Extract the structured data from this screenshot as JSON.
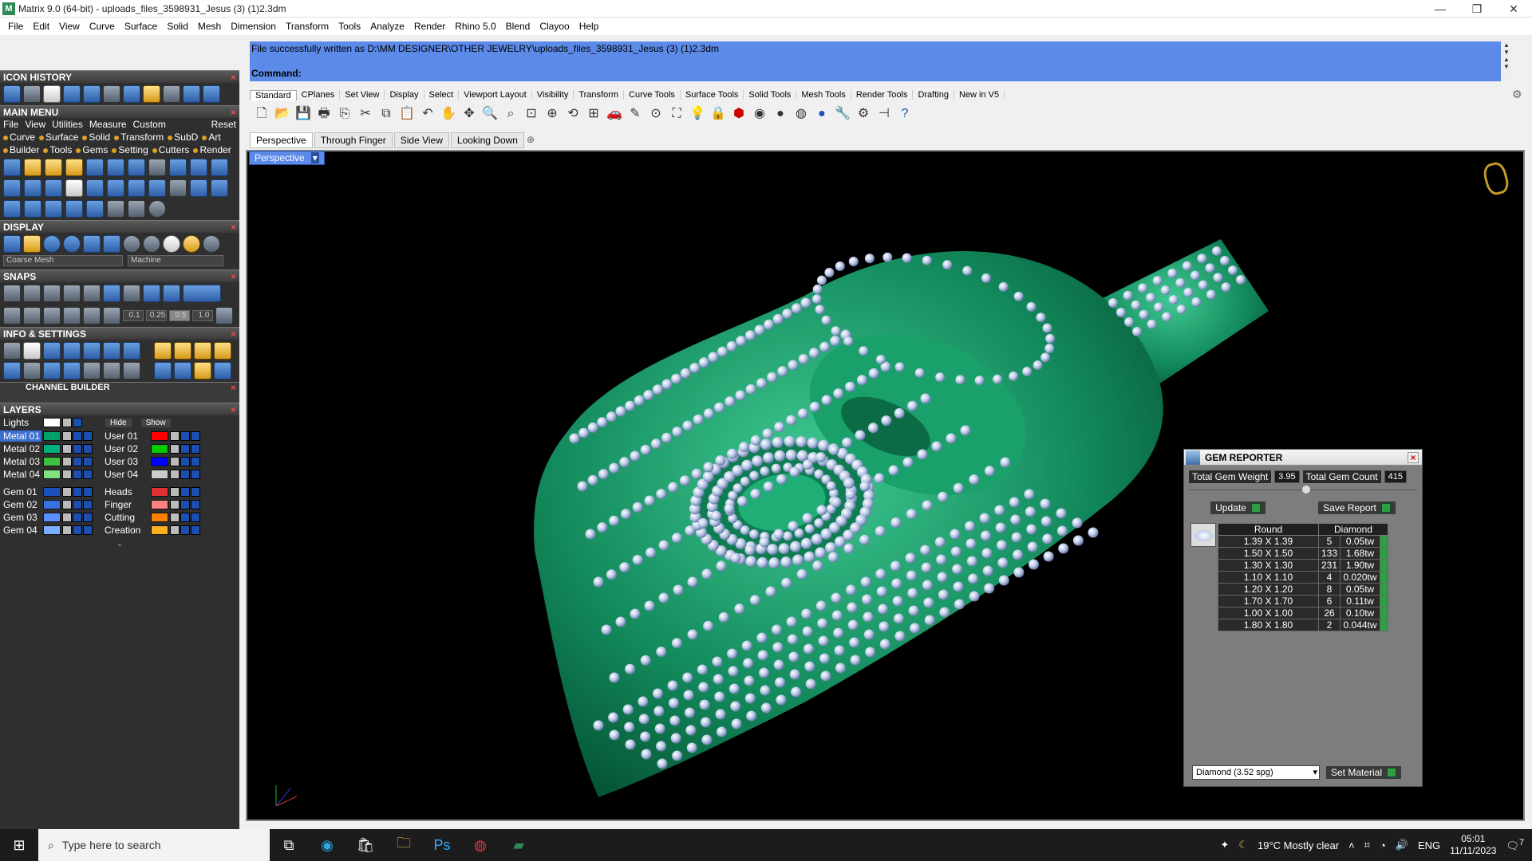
{
  "window": {
    "title": "Matrix 9.0 (64-bit) - uploads_files_3598931_Jesus (3) (1)2.3dm",
    "icon": "matrix-app-icon"
  },
  "menu": [
    "File",
    "Edit",
    "View",
    "Curve",
    "Surface",
    "Solid",
    "Mesh",
    "Dimension",
    "Transform",
    "Tools",
    "Analyze",
    "Render",
    "Rhino 5.0",
    "Blend",
    "Clayoo",
    "Help"
  ],
  "left_panel": {
    "icon_history": "ICON HISTORY",
    "main_menu": "MAIN MENU",
    "main_menu_items": [
      "File",
      "View",
      "Utilities",
      "Measure",
      "Custom",
      "Reset"
    ],
    "main_menu_row2": [
      "Curve",
      "Surface",
      "Solid",
      "Transform",
      "SubD",
      "Art"
    ],
    "main_menu_row3": [
      "Builder",
      "Tools",
      "Gems",
      "Setting",
      "Cutters",
      "Render"
    ],
    "display": "DISPLAY",
    "display_mesh": "Coarse Mesh",
    "display_mode": "Machine",
    "snaps": "SNAPS",
    "snap_values": [
      "0.1",
      "0.25",
      "0.5",
      "1.0"
    ],
    "info_settings": "INFO & SETTINGS",
    "channel_builder": "CHANNEL BUILDER",
    "layers": "LAYERS",
    "lights": "Lights",
    "hide": "Hide",
    "show": "Show",
    "layer_rows": [
      {
        "left": "Metal 01",
        "left_color": "#00a06a",
        "right": "User 01",
        "right_color": "#ff0000"
      },
      {
        "left": "Metal 02",
        "left_color": "#00b080",
        "right": "User 02",
        "right_color": "#00cc00"
      },
      {
        "left": "Metal 03",
        "left_color": "#40c040",
        "right": "User 03",
        "right_color": "#0000ff"
      },
      {
        "left": "Metal 04",
        "left_color": "#80e080",
        "right": "User 04",
        "right_color": "#cccccc"
      },
      {
        "left": "Gem 01",
        "left_color": "#1a50c0",
        "right": "Heads",
        "right_color": "#e03030"
      },
      {
        "left": "Gem 02",
        "left_color": "#3a70e0",
        "right": "Finger",
        "right_color": "#ff8080"
      },
      {
        "left": "Gem 03",
        "left_color": "#5a90ff",
        "right": "Cutting",
        "right_color": "#ff8000"
      },
      {
        "left": "Gem 04",
        "left_color": "#7ab0ff",
        "right": "Creation",
        "right_color": "#ffb020"
      }
    ]
  },
  "command": {
    "history": "File successfully written as D:\\MM DESIGNER\\OTHER JEWELRY\\uploads_files_3598931_Jesus (3) (1)2.3dm",
    "prompt": "Command:"
  },
  "toolbar_tabs": [
    "Standard",
    "CPlanes",
    "Set View",
    "Display",
    "Select",
    "Viewport Layout",
    "Visibility",
    "Transform",
    "Curve Tools",
    "Surface Tools",
    "Solid Tools",
    "Mesh Tools",
    "Render Tools",
    "Drafting",
    "New in V5"
  ],
  "view_tabs": [
    "Perspective",
    "Through Finger",
    "Side View",
    "Looking Down"
  ],
  "viewport_label": "Perspective",
  "gem_reporter": {
    "title": "GEM REPORTER",
    "total_weight_label": "Total Gem Weight",
    "total_weight": "3.95",
    "total_count_label": "Total Gem Count",
    "total_count": "415",
    "update": "Update",
    "save_report": "Save Report",
    "col_shape": "Round",
    "col_material": "Diamond",
    "rows": [
      {
        "size": "1.39 X 1.39",
        "count": "5",
        "weight": "0.05tw"
      },
      {
        "size": "1.50 X 1.50",
        "count": "133",
        "weight": "1.68tw"
      },
      {
        "size": "1.30 X 1.30",
        "count": "231",
        "weight": "1.90tw"
      },
      {
        "size": "1.10 X 1.10",
        "count": "4",
        "weight": "0.020tw"
      },
      {
        "size": "1.20 X 1.20",
        "count": "8",
        "weight": "0.05tw"
      },
      {
        "size": "1.70 X 1.70",
        "count": "6",
        "weight": "0.11tw"
      },
      {
        "size": "1.00 X 1.00",
        "count": "26",
        "weight": "0.10tw"
      },
      {
        "size": "1.80 X 1.80",
        "count": "2",
        "weight": "0.044tw"
      }
    ],
    "material": "Diamond    (3.52 spg)",
    "set_material": "Set Material"
  },
  "taskbar": {
    "search_placeholder": "Type here to search",
    "weather": "19°C  Mostly clear",
    "lang": "ENG",
    "time": "05:01",
    "date": "11/11/2023",
    "notifications": "7"
  },
  "colors": {
    "accent_blue": "#5c8ae8",
    "model_green": "#1f9a6b",
    "viewport_bg": "#000000",
    "go_green": "#2ea043"
  }
}
